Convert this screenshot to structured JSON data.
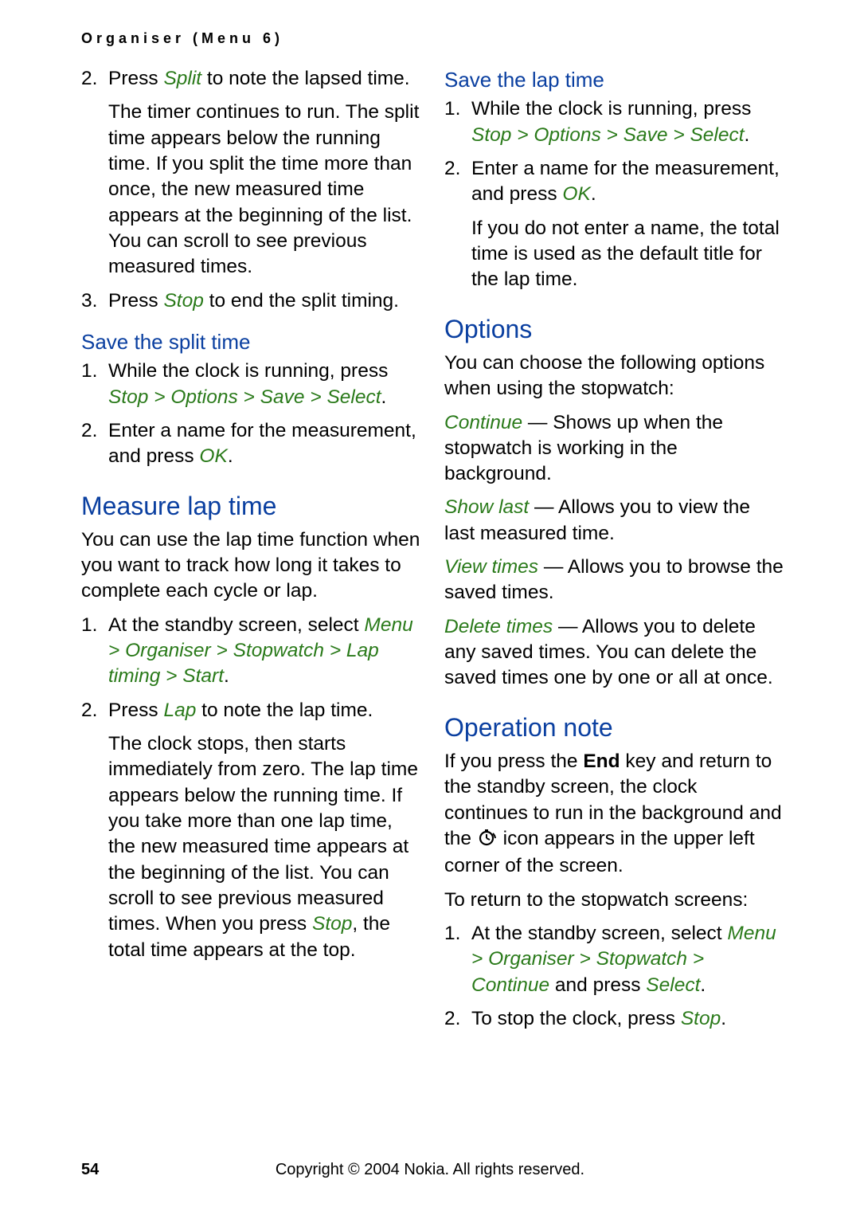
{
  "header": {
    "text": "Organiser (Menu 6)"
  },
  "footer": {
    "page_number": "54",
    "copyright": "Copyright © 2004 Nokia. All rights reserved."
  },
  "left": {
    "intro_list": {
      "i2_pre": "Press ",
      "i2_accent": "Split",
      "i2_post": " to note the lapsed time.",
      "i2_para": "The timer continues to run. The split time appears below the running time. If you split the time more than once, the new measured time appears at the beginning of the list. You can scroll to see previous measured times.",
      "i3_pre": "Press ",
      "i3_accent": "Stop",
      "i3_post": " to end the split timing."
    },
    "save_split": {
      "heading": "Save the split time",
      "s1_pre": "While the clock is running, press ",
      "s1_path": "Stop > Options > Save > Select",
      "s1_post": ".",
      "s2_pre": "Enter a name for the measurement, and press ",
      "s2_accent": "OK",
      "s2_post": "."
    },
    "measure_lap": {
      "heading": "Measure lap time",
      "intro": "You can use the lap time function when you want to track how long it takes to complete each cycle or lap.",
      "m1_pre": "At the standby screen, select ",
      "m1_path": "Menu > Organiser > Stopwatch > Lap timing > Start",
      "m1_post": ".",
      "m2_pre": "Press ",
      "m2_accent": "Lap",
      "m2_post": " to note the lap time.",
      "m2_para_a": "The clock stops, then starts immediately from zero. The lap time appears below the running time. If you take more than one lap time, the new measured time appears at the beginning of the list. You can scroll to see previous measured times. When you press ",
      "m2_para_accent": "Stop",
      "m2_para_b": ", the total time appears at the top."
    }
  },
  "right": {
    "save_lap": {
      "heading": "Save the lap time",
      "s1_pre": "While the clock is running, press ",
      "s1_path": "Stop > Options > Save > Select",
      "s1_post": ".",
      "s2_pre": "Enter a name for the measurement, and press ",
      "s2_accent": "OK",
      "s2_post": ".",
      "s2_para": "If you do not enter a name, the total time is used as the default title for the lap time."
    },
    "options": {
      "heading": "Options",
      "intro": "You can choose the following options when using the stopwatch:",
      "o1_accent": "Continue",
      "o1_txt": " — Shows up when the stopwatch is working in the background.",
      "o2_accent": "Show last",
      "o2_txt": " — Allows you to view the last measured time.",
      "o3_accent": "View times",
      "o3_txt": " — Allows you to browse the saved times.",
      "o4_accent": "Delete times",
      "o4_txt": " — Allows you to delete any saved times. You can delete the saved times one by one or all at once."
    },
    "operation": {
      "heading": "Operation note",
      "p1a": "If you press the ",
      "p1_bold": "End",
      "p1b": " key and return to the standby screen, the clock continues to run in the background and the ",
      "p1c": " icon appears in the upper left corner of the screen.",
      "p2": "To return to the stopwatch screens:",
      "r1_pre": "At the standby screen, select ",
      "r1_path": "Menu > Organiser > Stopwatch > Continue",
      "r1_mid": " and press ",
      "r1_accent": "Select",
      "r1_post": ".",
      "r2_pre": "To stop the clock, press ",
      "r2_accent": "Stop",
      "r2_post": "."
    }
  }
}
